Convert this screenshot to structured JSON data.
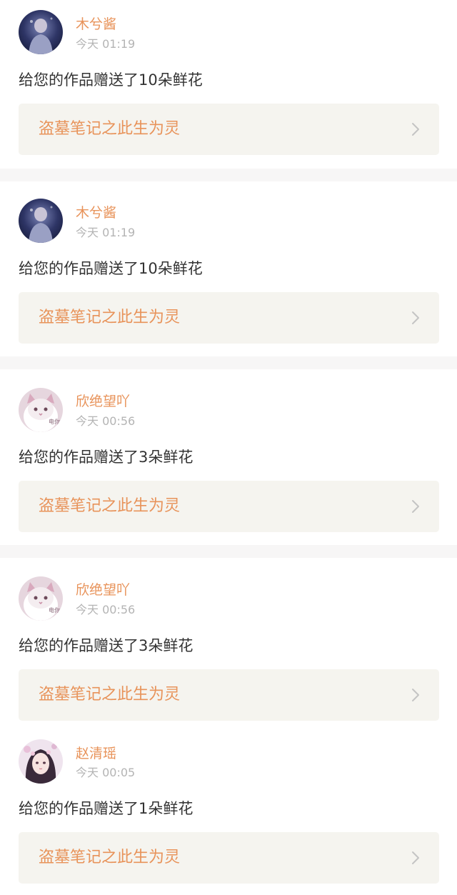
{
  "notifications": [
    {
      "user": "木兮酱",
      "time": "今天 01:19",
      "message": "给您的作品赠送了10朵鲜花",
      "work_title": "盗墓笔记之此生为灵",
      "avatar_icon": "profile-photo-dark-icon"
    },
    {
      "user": "木兮酱",
      "time": "今天 01:19",
      "message": "给您的作品赠送了10朵鲜花",
      "work_title": "盗墓笔记之此生为灵",
      "avatar_icon": "profile-photo-dark-icon"
    },
    {
      "user": "欣绝望吖",
      "time": "今天 00:56",
      "message": "给您的作品赠送了3朵鲜花",
      "work_title": "盗墓笔记之此生为灵",
      "avatar_icon": "cat-photo-icon",
      "avatar_caption": "电你"
    },
    {
      "user": "欣绝望吖",
      "time": "今天 00:56",
      "message": "给您的作品赠送了3朵鲜花",
      "work_title": "盗墓笔记之此生为灵",
      "avatar_icon": "cat-photo-icon",
      "avatar_caption": "电你"
    },
    {
      "user": "赵清瑶",
      "time": "今天 00:05",
      "message": "给您的作品赠送了1朵鲜花",
      "work_title": "盗墓笔记之此生为灵",
      "avatar_icon": "illustrated-girl-icon"
    }
  ],
  "colors": {
    "accent": "#e8935a",
    "timestamp": "#b4b4b4",
    "body_text": "#333333",
    "link_card_bg": "#f5f4ef",
    "separator": "#f7f6f6",
    "chevron": "#c4c4c4"
  },
  "chevron_icon": "chevron-right-icon"
}
